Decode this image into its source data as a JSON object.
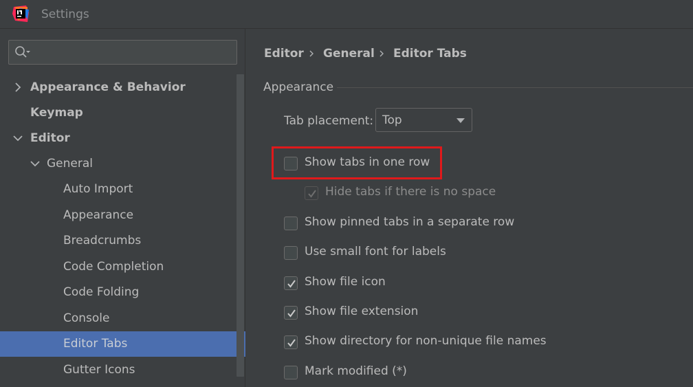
{
  "window": {
    "title": "Settings"
  },
  "search": {
    "value": "",
    "placeholder": ""
  },
  "sidebar": {
    "items": [
      {
        "label": "Appearance & Behavior",
        "arrow": "right"
      },
      {
        "label": "Keymap",
        "arrow": ""
      },
      {
        "label": "Editor",
        "arrow": "down"
      },
      {
        "label": "General",
        "arrow": "down"
      },
      {
        "label": "Auto Import"
      },
      {
        "label": "Appearance"
      },
      {
        "label": "Breadcrumbs"
      },
      {
        "label": "Code Completion"
      },
      {
        "label": "Code Folding"
      },
      {
        "label": "Console"
      },
      {
        "label": "Editor Tabs",
        "selected": true
      },
      {
        "label": "Gutter Icons"
      }
    ]
  },
  "breadcrumb": {
    "items": [
      "Editor",
      "General",
      "Editor Tabs"
    ]
  },
  "appearance": {
    "title": "Appearance",
    "tab_placement": {
      "label": "Tab placement:",
      "value": "Top"
    },
    "options": [
      {
        "label": "Show tabs in one row",
        "checked": false,
        "enabled": true
      },
      {
        "label": "Hide tabs if there is no space",
        "checked": true,
        "enabled": false
      },
      {
        "label": "Show pinned tabs in a separate row",
        "checked": false,
        "enabled": true
      },
      {
        "label": "Use small font for labels",
        "checked": false,
        "enabled": true
      },
      {
        "label": "Show file icon",
        "checked": true,
        "enabled": true
      },
      {
        "label": "Show file extension",
        "checked": true,
        "enabled": true
      },
      {
        "label": "Show directory for non-unique file names",
        "checked": true,
        "enabled": true
      },
      {
        "label": "Mark modified (*)",
        "checked": false,
        "enabled": true
      }
    ]
  },
  "colors": {
    "background": "#3c3f41",
    "selection": "#4b6eaf",
    "highlight": "#e0191b"
  }
}
